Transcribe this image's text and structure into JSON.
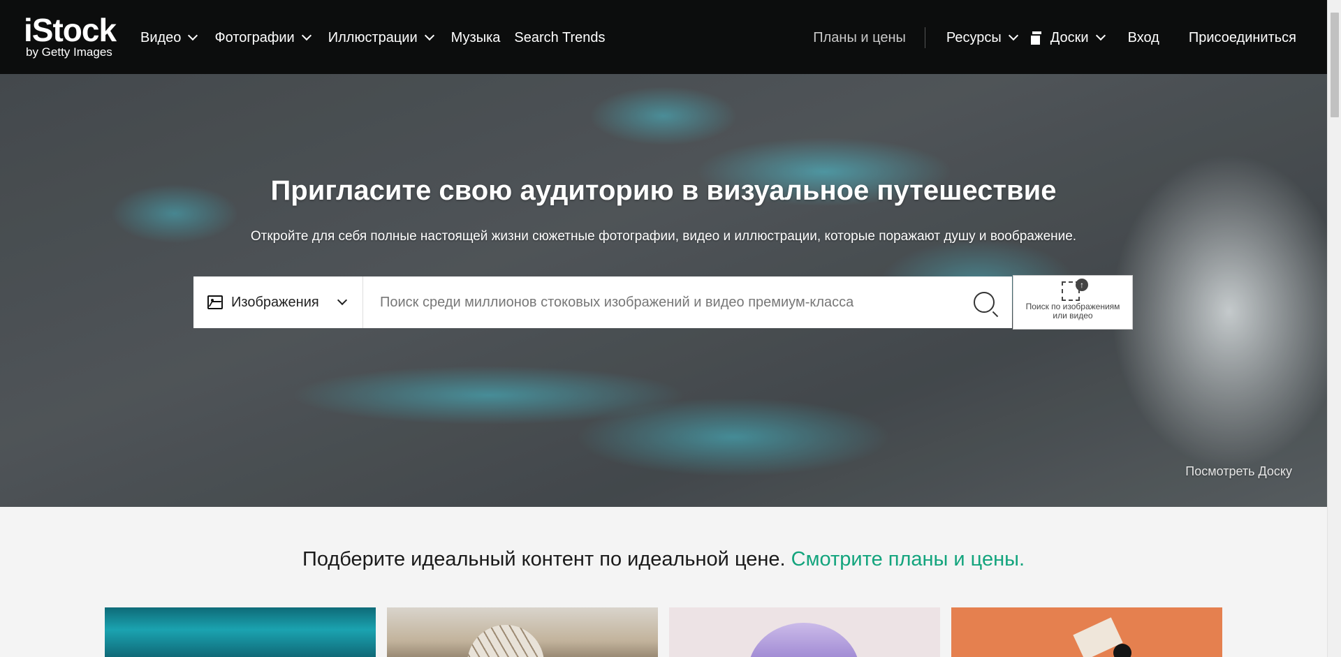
{
  "brand": {
    "name": "iStock",
    "tagline": "by Getty Images"
  },
  "nav": {
    "left": [
      {
        "label": "Видео",
        "dropdown": true
      },
      {
        "label": "Фотографии",
        "dropdown": true
      },
      {
        "label": "Иллюстрации",
        "dropdown": true
      },
      {
        "label": "Музыка",
        "dropdown": false
      },
      {
        "label": "Search Trends",
        "dropdown": false
      }
    ],
    "plans": "Планы и цены",
    "resources": "Ресурсы",
    "boards": "Доски",
    "signin": "Вход",
    "join": "Присоединиться"
  },
  "hero": {
    "title": "Пригласите свою аудиторию в визуальное путешествие",
    "subtitle": "Откройте для себя полные настоящей жизни сюжетные фотографии, видео и иллюстрации, которые поражают душу и воображение.",
    "board_link": "Посмотреть Доску"
  },
  "search": {
    "type_label": "Изображения",
    "placeholder": "Поиск среди миллионов стоковых изображений и видео премиум-класса",
    "value": "",
    "visual_search_label": "Поиск по изображениям или видео"
  },
  "teaser": {
    "text": "Подберите идеальный контент по идеальной цене.",
    "link": "Смотрите планы и цены."
  },
  "colors": {
    "topbar": "#0c0d0d",
    "accent_green": "#13a47d"
  }
}
